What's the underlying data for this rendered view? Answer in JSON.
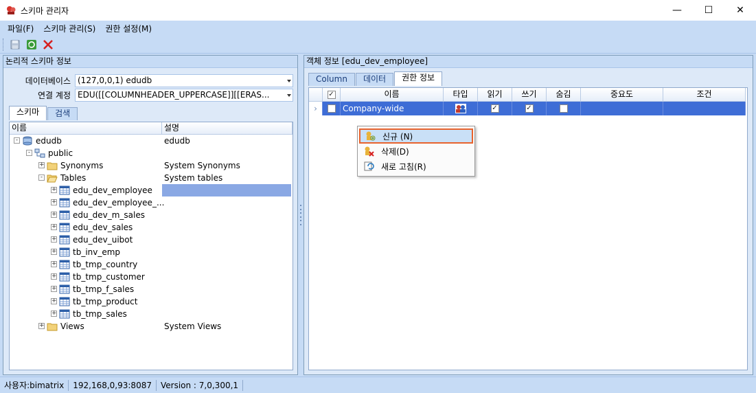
{
  "window": {
    "title": "스키마 관리자",
    "controls": [
      "—",
      "☐",
      "✕"
    ]
  },
  "menu": [
    {
      "label": "파일(F)"
    },
    {
      "label": "스키마 관리(S)"
    },
    {
      "label": "권한 설정(M)"
    }
  ],
  "toolbar": {
    "icons": [
      "save-icon",
      "refresh-icon",
      "delete-icon"
    ]
  },
  "left_panel": {
    "header": "논리적 스키마 정보",
    "database_label": "데이터베이스",
    "database_value": "(127,0,0,1) edudb",
    "account_label": "연결 계정",
    "account_value": "EDU([[COLUMNHEADER_UPPERCASE]][[ERAS...",
    "tabs": [
      "스키마",
      "검색"
    ],
    "tree_columns": [
      "이름",
      "설명"
    ],
    "tree": [
      {
        "label": "edudb",
        "desc": "edudb",
        "level": 0,
        "icon": "database",
        "expander": "-"
      },
      {
        "label": "public",
        "desc": "",
        "level": 1,
        "icon": "schema",
        "expander": "-"
      },
      {
        "label": "Synonyms",
        "desc": "System Synonyms",
        "level": 2,
        "icon": "folder",
        "expander": "+"
      },
      {
        "label": "Tables",
        "desc": "System tables",
        "level": 2,
        "icon": "folder-open",
        "expander": "-"
      },
      {
        "label": "edu_dev_employee",
        "desc": "",
        "level": 3,
        "icon": "table",
        "expander": "+"
      },
      {
        "label": "edu_dev_employee_...",
        "desc": "",
        "level": 3,
        "icon": "table",
        "expander": "+"
      },
      {
        "label": "edu_dev_m_sales",
        "desc": "",
        "level": 3,
        "icon": "table",
        "expander": "+"
      },
      {
        "label": "edu_dev_sales",
        "desc": "",
        "level": 3,
        "icon": "table",
        "expander": "+"
      },
      {
        "label": "edu_dev_uibot",
        "desc": "",
        "level": 3,
        "icon": "table",
        "expander": "+"
      },
      {
        "label": "tb_inv_emp",
        "desc": "",
        "level": 3,
        "icon": "table",
        "expander": "+"
      },
      {
        "label": "tb_tmp_country",
        "desc": "",
        "level": 3,
        "icon": "table",
        "expander": "+"
      },
      {
        "label": "tb_tmp_customer",
        "desc": "",
        "level": 3,
        "icon": "table",
        "expander": "+"
      },
      {
        "label": "tb_tmp_f_sales",
        "desc": "",
        "level": 3,
        "icon": "table",
        "expander": "+"
      },
      {
        "label": "tb_tmp_product",
        "desc": "",
        "level": 3,
        "icon": "table",
        "expander": "+"
      },
      {
        "label": "tb_tmp_sales",
        "desc": "",
        "level": 3,
        "icon": "table",
        "expander": "+"
      },
      {
        "label": "Views",
        "desc": "System Views",
        "level": 2,
        "icon": "folder",
        "expander": "+"
      }
    ]
  },
  "right_panel": {
    "header": "객체 정보  [edu_dev_employee]",
    "tabs": [
      "Column",
      "데이터",
      "권한 정보"
    ],
    "grid_columns": [
      "☑",
      "이름",
      "타입",
      "읽기",
      "쓰기",
      "숨김",
      "중요도",
      "조건"
    ],
    "rows": [
      {
        "name": "Company-wide",
        "type_icon": "group-icon",
        "read": true,
        "write": true,
        "hidden": false,
        "importance": "",
        "condition": ""
      }
    ]
  },
  "context_menu": [
    {
      "label": "신규 (N)",
      "icon": "new-icon"
    },
    {
      "label": "삭제(D)",
      "icon": "delete-icon"
    },
    {
      "label": "새로 고침(R)",
      "icon": "refresh-icon"
    }
  ],
  "status": {
    "user": "사용자:bimatrix",
    "server": "192,168,0,93:8087",
    "version": "Version : 7,0,300,1"
  },
  "colors": {
    "chrome": "#c6dbf5",
    "selection": "#3e6dd6",
    "highlight_border": "#e8622c"
  }
}
